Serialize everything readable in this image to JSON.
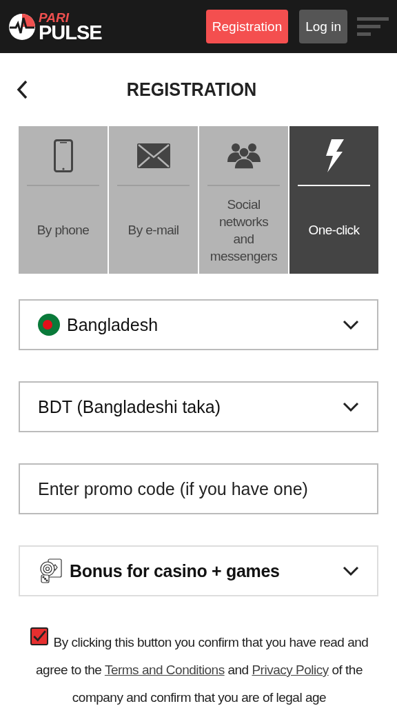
{
  "header": {
    "logo_top": "PARI",
    "logo_bottom": "PULSE",
    "buttons": [
      {
        "label": "Registration",
        "kind": "primary"
      },
      {
        "label": "Log in",
        "kind": "secondary"
      }
    ]
  },
  "page_title": "REGISTRATION",
  "tabs": [
    {
      "label": "By phone",
      "kind": "phone",
      "selected": false
    },
    {
      "label": "By e-mail",
      "kind": "email",
      "selected": false
    },
    {
      "label": "Social networks and messengers",
      "kind": "social",
      "selected": false
    },
    {
      "label": "One-click",
      "kind": "bolt",
      "selected": true
    }
  ],
  "fields": [
    {
      "kind": "country",
      "value": "Bangladesh"
    },
    {
      "kind": "select",
      "value": "BDT (Bangladeshi taka)"
    },
    {
      "kind": "input",
      "placeholder": "Enter promo code (if you have one)"
    },
    {
      "kind": "bonus",
      "value": "Bonus for casino + games"
    }
  ],
  "consent": {
    "checked": true,
    "text_before": "By clicking this button you confirm that you have read and agree to the ",
    "terms_link": "Terms and Conditions",
    "text_middle": " and ",
    "privacy_link": "Privacy Policy",
    "text_after": " of the company and confirm that you are of legal age"
  }
}
